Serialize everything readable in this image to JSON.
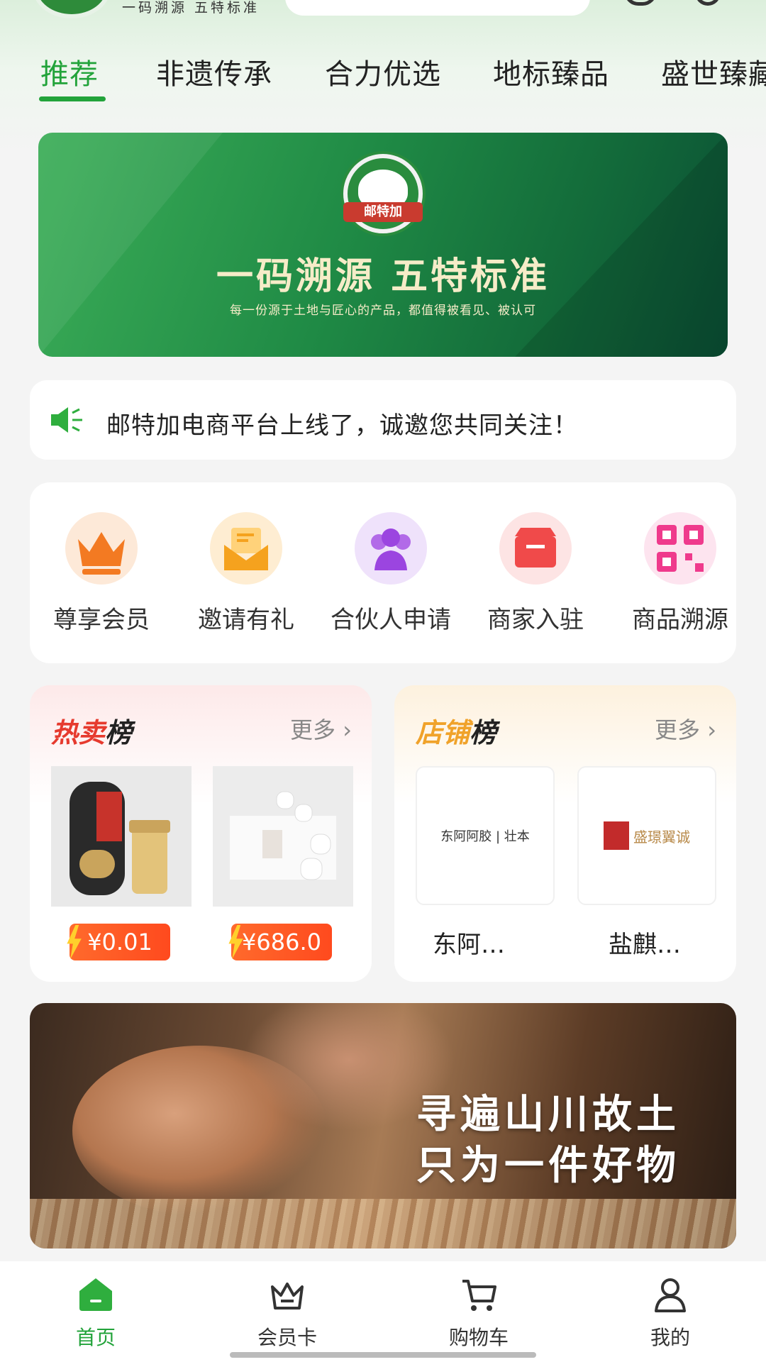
{
  "header": {
    "slogan": "一码溯源 五特标准"
  },
  "tabs": [
    {
      "label": "推荐",
      "active": true
    },
    {
      "label": "非遗传承",
      "active": false
    },
    {
      "label": "合力优选",
      "active": false
    },
    {
      "label": "地标臻品",
      "active": false
    },
    {
      "label": "盛世臻藏",
      "active": false
    }
  ],
  "hero": {
    "logo_text": "邮特加",
    "title": "一码溯源 五特标准",
    "subtitle": "每一份源于土地与匠心的产品，都值得被看见、被认可"
  },
  "notice": {
    "text": "邮特加电商平台上线了，诚邀您共同关注！"
  },
  "quick_entries": [
    {
      "label": "尊享会员",
      "icon": "crown-icon"
    },
    {
      "label": "邀请有礼",
      "icon": "envelope-icon"
    },
    {
      "label": "合伙人申请",
      "icon": "partners-icon"
    },
    {
      "label": "商家入驻",
      "icon": "store-icon"
    },
    {
      "label": "商品溯源",
      "icon": "qrcode-icon"
    }
  ],
  "hot_rank": {
    "title_a": "热卖",
    "title_b": "榜",
    "more": "更多 ›",
    "products": [
      {
        "price": "¥0.01"
      },
      {
        "price": "¥686.0"
      }
    ]
  },
  "shop_rank": {
    "title_a": "店铺",
    "title_b": "榜",
    "more": "更多 ›",
    "shops": [
      {
        "name": "东阿…",
        "logo_text": "东阿阿胶 | 壮本"
      },
      {
        "name": "盐麒…",
        "logo_text": "盛璟翼诚"
      }
    ]
  },
  "craft_banner": {
    "line1": "寻遍山川故土",
    "line2": "只为一件好物"
  },
  "bottom_nav": [
    {
      "label": "首页",
      "active": true,
      "icon": "home-icon"
    },
    {
      "label": "会员卡",
      "active": false,
      "icon": "member-card-icon"
    },
    {
      "label": "购物车",
      "active": false,
      "icon": "cart-icon"
    },
    {
      "label": "我的",
      "active": false,
      "icon": "profile-icon"
    }
  ],
  "colors": {
    "accent": "#22a33a",
    "hot": "#e63a2e",
    "shop": "#f0a22a",
    "price": "#ff5a22"
  }
}
